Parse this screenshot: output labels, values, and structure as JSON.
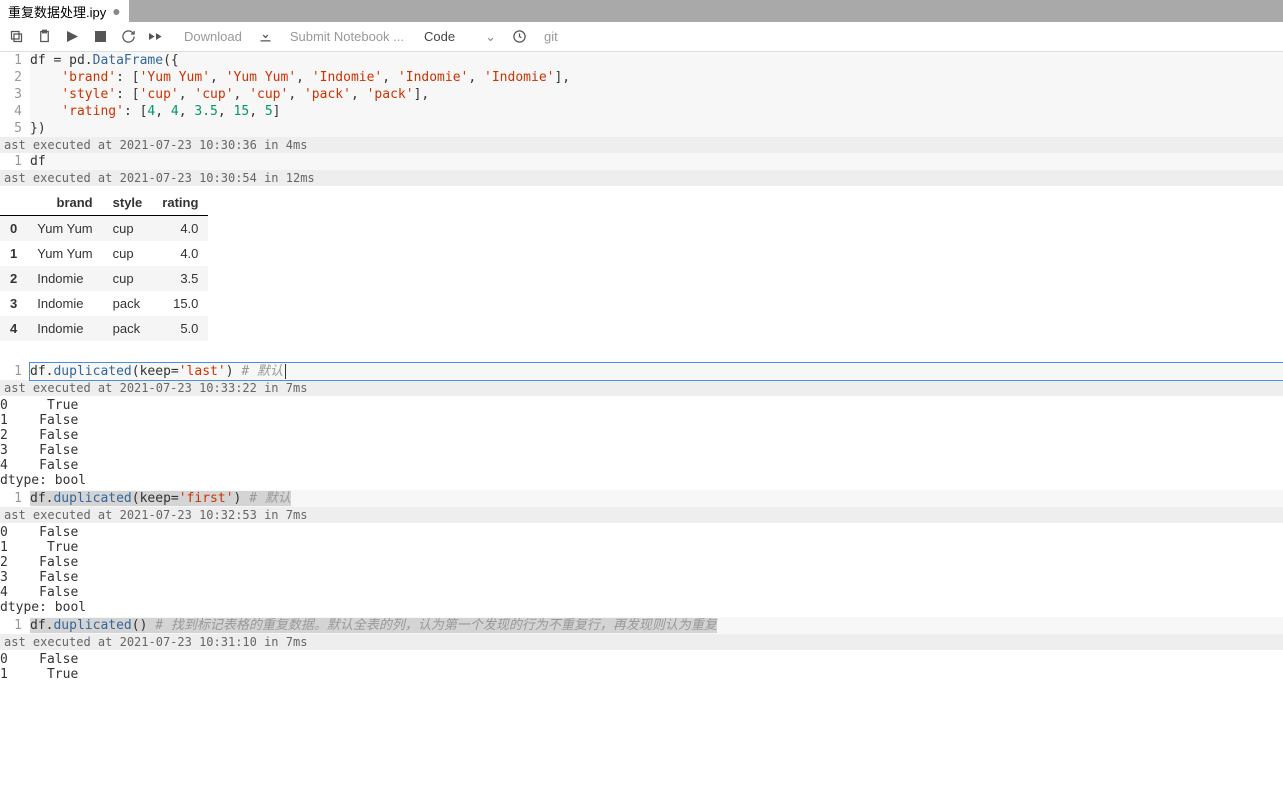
{
  "tab": {
    "title": "重复数据处理.ipy"
  },
  "toolbar": {
    "download": "Download",
    "submit": "Submit Notebook ...",
    "celltype": "Code",
    "git": "git"
  },
  "cells": [
    {
      "lines": [
        "1",
        "2",
        "3",
        "4",
        "5"
      ],
      "code_tokens": [
        [
          {
            "t": "df = pd.",
            "c": ""
          },
          {
            "t": "DataFrame",
            "c": "fn"
          },
          {
            "t": "({",
            "c": ""
          }
        ],
        [
          {
            "t": "    ",
            "c": ""
          },
          {
            "t": "'brand'",
            "c": "str"
          },
          {
            "t": ": [",
            "c": ""
          },
          {
            "t": "'Yum Yum'",
            "c": "str"
          },
          {
            "t": ", ",
            "c": ""
          },
          {
            "t": "'Yum Yum'",
            "c": "str"
          },
          {
            "t": ", ",
            "c": ""
          },
          {
            "t": "'Indomie'",
            "c": "str"
          },
          {
            "t": ", ",
            "c": ""
          },
          {
            "t": "'Indomie'",
            "c": "str"
          },
          {
            "t": ", ",
            "c": ""
          },
          {
            "t": "'Indomie'",
            "c": "str"
          },
          {
            "t": "],",
            "c": ""
          }
        ],
        [
          {
            "t": "    ",
            "c": ""
          },
          {
            "t": "'style'",
            "c": "str"
          },
          {
            "t": ": [",
            "c": ""
          },
          {
            "t": "'cup'",
            "c": "str"
          },
          {
            "t": ", ",
            "c": ""
          },
          {
            "t": "'cup'",
            "c": "str"
          },
          {
            "t": ", ",
            "c": ""
          },
          {
            "t": "'cup'",
            "c": "str"
          },
          {
            "t": ", ",
            "c": ""
          },
          {
            "t": "'pack'",
            "c": "str"
          },
          {
            "t": ", ",
            "c": ""
          },
          {
            "t": "'pack'",
            "c": "str"
          },
          {
            "t": "],",
            "c": ""
          }
        ],
        [
          {
            "t": "    ",
            "c": ""
          },
          {
            "t": "'rating'",
            "c": "str"
          },
          {
            "t": ": [",
            "c": ""
          },
          {
            "t": "4",
            "c": "num"
          },
          {
            "t": ", ",
            "c": ""
          },
          {
            "t": "4",
            "c": "num"
          },
          {
            "t": ", ",
            "c": ""
          },
          {
            "t": "3.5",
            "c": "num"
          },
          {
            "t": ", ",
            "c": ""
          },
          {
            "t": "15",
            "c": "num"
          },
          {
            "t": ", ",
            "c": ""
          },
          {
            "t": "5",
            "c": "num"
          },
          {
            "t": "]",
            "c": ""
          }
        ],
        [
          {
            "t": "})",
            "c": ""
          }
        ]
      ],
      "exec": "ast executed at 2021-07-23 10:30:36 in 4ms"
    },
    {
      "lines": [
        "1"
      ],
      "code_tokens": [
        [
          {
            "t": "df",
            "c": ""
          }
        ]
      ],
      "exec": "ast executed at 2021-07-23 10:30:54 in 12ms"
    }
  ],
  "df_table": {
    "headers": [
      "",
      "brand",
      "style",
      "rating"
    ],
    "rows": [
      [
        "0",
        "Yum Yum",
        "cup",
        "4.0"
      ],
      [
        "1",
        "Yum Yum",
        "cup",
        "4.0"
      ],
      [
        "2",
        "Indomie",
        "cup",
        "3.5"
      ],
      [
        "3",
        "Indomie",
        "pack",
        "15.0"
      ],
      [
        "4",
        "Indomie",
        "pack",
        "5.0"
      ]
    ]
  },
  "cell3": {
    "line": "1",
    "tokens": [
      {
        "t": "df.",
        "c": ""
      },
      {
        "t": "duplicated",
        "c": "attr"
      },
      {
        "t": "(",
        "c": ""
      },
      {
        "t": "keep",
        "c": ""
      },
      {
        "t": "=",
        "c": ""
      },
      {
        "t": "'last'",
        "c": "str"
      },
      {
        "t": ") ",
        "c": ""
      },
      {
        "t": "# 默认",
        "c": "comment"
      }
    ],
    "exec": "ast executed at 2021-07-23 10:33:22 in 7ms",
    "out": "0     True\n1    False\n2    False\n3    False\n4    False\ndtype: bool"
  },
  "cell4": {
    "line": "1",
    "tokens": [
      {
        "t": "df.",
        "c": "",
        "hl": true
      },
      {
        "t": "duplicated",
        "c": "attr",
        "hl": true
      },
      {
        "t": "(",
        "c": "",
        "hl": true
      },
      {
        "t": "keep",
        "c": "",
        "hl": true
      },
      {
        "t": "=",
        "c": "",
        "hl": true
      },
      {
        "t": "'first'",
        "c": "str",
        "hl": true
      },
      {
        "t": ") ",
        "c": "",
        "hl": true
      },
      {
        "t": "# 默认",
        "c": "comment",
        "hl": true
      }
    ],
    "exec": "ast executed at 2021-07-23 10:32:53 in 7ms",
    "out": "0    False\n1     True\n2    False\n3    False\n4    False\ndtype: bool"
  },
  "cell5": {
    "line": "1",
    "tokens": [
      {
        "t": "df.",
        "c": "",
        "hl": true
      },
      {
        "t": "duplicated",
        "c": "attr",
        "hl": true
      },
      {
        "t": "() ",
        "c": "",
        "hl": true
      },
      {
        "t": "# 找到标记表格的重复数据。默认全表的列，认为第一个发现的行为不重复行，再发现则认为重复",
        "c": "comment",
        "hl": true
      }
    ],
    "exec": "ast executed at 2021-07-23 10:31:10 in 7ms",
    "out": "0    False\n1     True"
  }
}
